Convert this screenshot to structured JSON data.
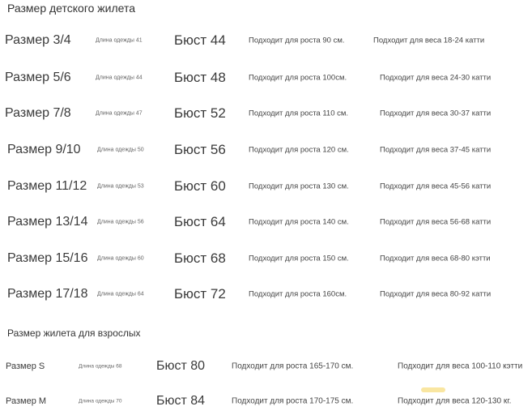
{
  "kids_heading": "Размер детского жилета",
  "kids_rows": [
    {
      "size": "Размер 3/4",
      "length": "Длина одежды 41",
      "bust": "Бюст 44",
      "height": "Подходит для роста 90 см.",
      "weight": "Подходит для веса 18-24 катти"
    },
    {
      "size": "Размер 5/6",
      "length": "Длина одежды 44",
      "bust": "Бюст 48",
      "height": "Подходит для роста 100см.",
      "weight": "Подходит для веса 24-30 катти"
    },
    {
      "size": "Размер 7/8",
      "length": "Длина одежды 47",
      "bust": "Бюст 52",
      "height": "Подходит для роста 110 см.",
      "weight": "Подходит для веса 30-37 катти"
    },
    {
      "size": "Размер 9/10",
      "length": "Длина одежды 50",
      "bust": "Бюст 56",
      "height": "Подходит для роста 120 см.",
      "weight": "Подходит для веса 37-45 катти"
    },
    {
      "size": "Размер 11/12",
      "length": "Длина одежды 53",
      "bust": "Бюст 60",
      "height": "Подходит для роста 130 см.",
      "weight": "Подходит для веса 45-56 катти"
    },
    {
      "size": "Размер 13/14",
      "length": "Длина одежды 56",
      "bust": "Бюст 64",
      "height": "Подходит для роста 140 см.",
      "weight": "Подходит для веса 56-68 катти"
    },
    {
      "size": "Размер 15/16",
      "length": "Длина одежды 60",
      "bust": "Бюст 68",
      "height": "Подходит для роста 150 см.",
      "weight": "Подходит для веса 68-80 кэтти"
    },
    {
      "size": "Размер 17/18",
      "length": "Длина одежды 64",
      "bust": "Бюст 72",
      "height": "Подходит для роста 160см.",
      "weight": "Подходит для веса 80-92 катти"
    }
  ],
  "adult_heading": "Размер жилета для взрослых",
  "adult_rows": [
    {
      "size": "Размер S",
      "length": "Длина одежды 68",
      "bust": "Бюст 80",
      "height": "Подходит для роста 165-170 см.",
      "weight": "Подходит для веса 100-110 кэтти"
    },
    {
      "size": "Размер M",
      "length": "Длина одежды 70",
      "bust": "Бюст 84",
      "height": "Подходит для роста 170-175 см.",
      "weight": "Подходит для веса 120-130 кг."
    }
  ]
}
